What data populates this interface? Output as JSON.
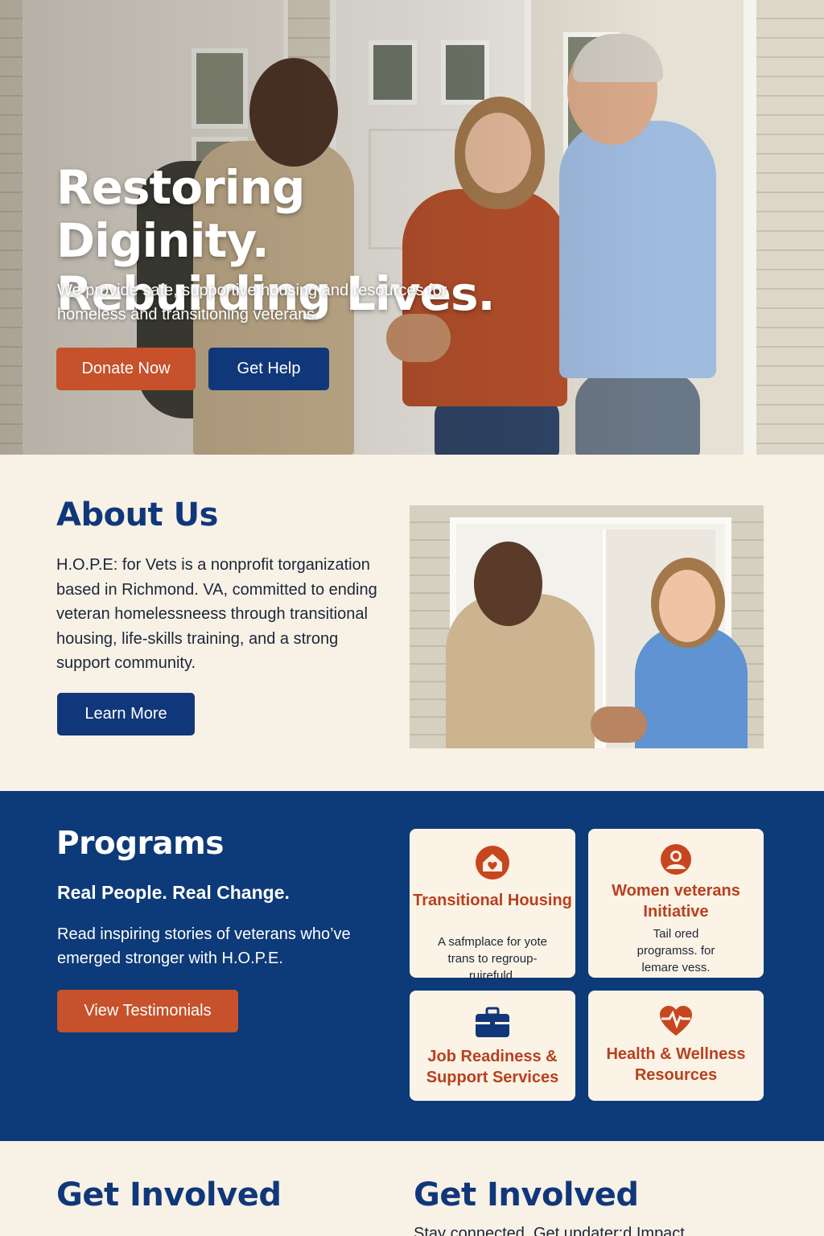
{
  "hero": {
    "title_line1": "Restoring Diginity.",
    "title_line2": "Rebuilding Lives.",
    "subtitle": "We provide safe, supportive housing and resources for homeless and transitioning veterans.",
    "donate_label": "Donate Now",
    "help_label": "Get Help"
  },
  "about": {
    "heading": "About Us",
    "body": "H.O.P.E: for Vets is a nonprofit torganization based in Richmond. VA, committed to ending veteran homelessneess through transitional housing, life-skills training, and a strong support community.",
    "button_label": "Learn More"
  },
  "programs": {
    "heading": "Programs",
    "subheading": "Real People. Real Change.",
    "body": "Read inspiring stories of veterans who’ve emerged stronger with H.O.P.E.",
    "button_label": "View Testimonials",
    "cards": [
      {
        "icon": "home-heart-icon",
        "title": "Transitional Housing",
        "desc": "A safmplace for yote trans to regroup-ruirefuld."
      },
      {
        "icon": "woman-veteran-icon",
        "title": "Women veterans Initiative",
        "desc": "Tail ored programss. for lemare vess."
      },
      {
        "icon": "briefcase-icon",
        "title": "Job Readiness & Support Services",
        "desc": ""
      },
      {
        "icon": "heart-pulse-icon",
        "title": "Health & Wellness Resources",
        "desc": ""
      }
    ]
  },
  "involved": {
    "heading_left": "Get Involved",
    "heading_right": "Get Involved",
    "body_right": "Stay connected. Get updater:d Impact"
  },
  "colors": {
    "navy": "#10377a",
    "orange": "#c6512a",
    "cream": "#f8f1e6",
    "card_text": "#b8401f"
  }
}
